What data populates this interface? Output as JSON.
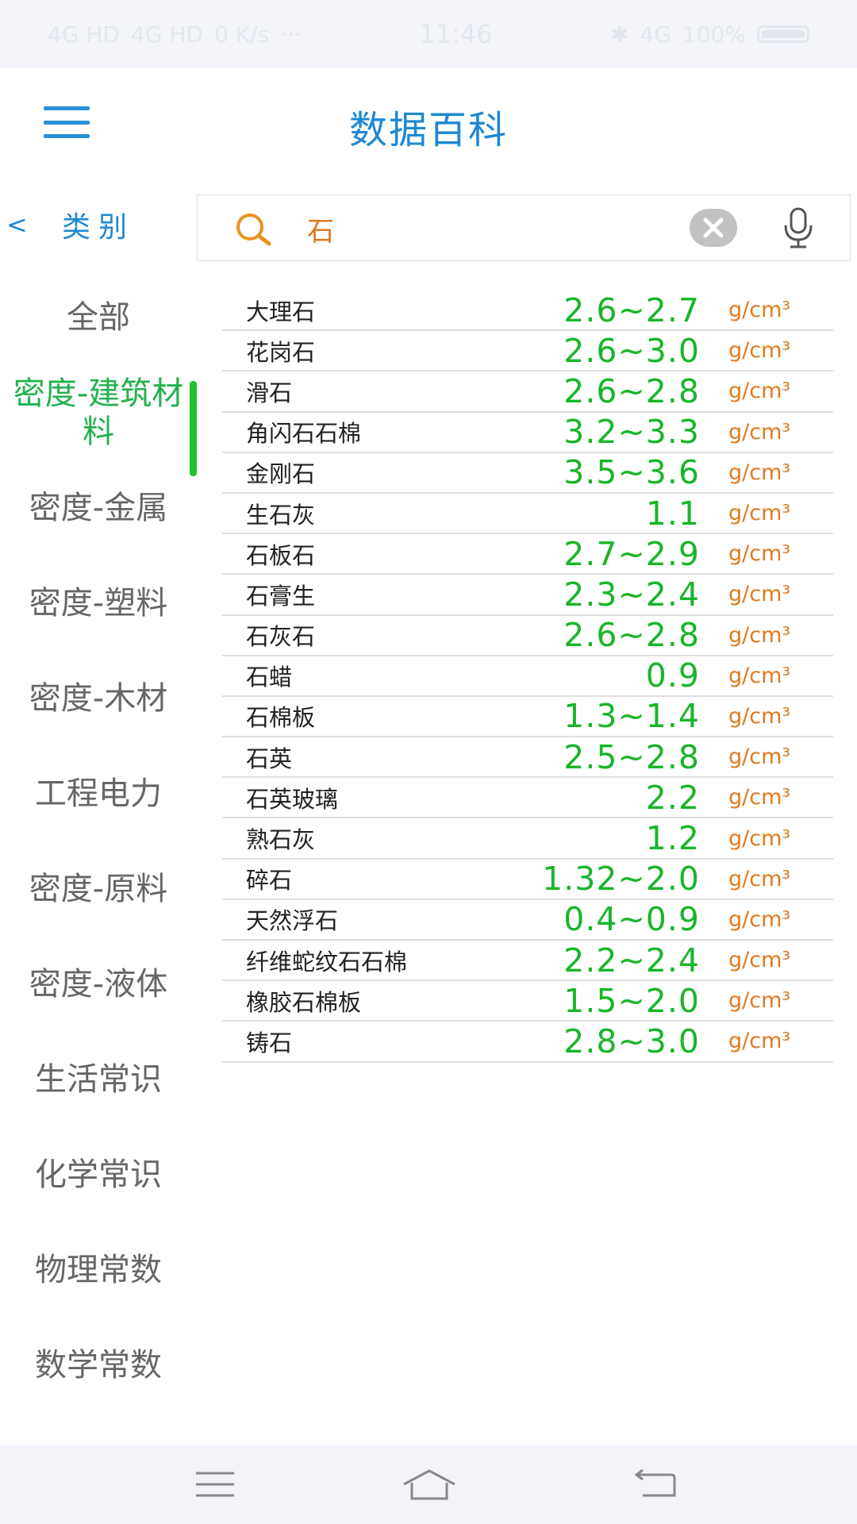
{
  "status_bar": {
    "signal1": "4G HD",
    "signal2": "4G HD",
    "speed": "0 K/s",
    "dots": "···",
    "time": "11:46",
    "network": "4G",
    "battery": "100%"
  },
  "header": {
    "title": "数据百科"
  },
  "category_header": {
    "back": "<",
    "label": "类别"
  },
  "search": {
    "value": "石",
    "placeholder": ""
  },
  "sidebar": {
    "active_index": 1,
    "items": [
      {
        "label": "全部"
      },
      {
        "label": "密度-建筑材料"
      },
      {
        "label": "密度-金属"
      },
      {
        "label": "密度-塑料"
      },
      {
        "label": "密度-木材"
      },
      {
        "label": "工程电力"
      },
      {
        "label": "密度-原料"
      },
      {
        "label": "密度-液体"
      },
      {
        "label": "生活常识"
      },
      {
        "label": "化学常识"
      },
      {
        "label": "物理常数"
      },
      {
        "label": "数学常数"
      }
    ]
  },
  "results": [
    {
      "name": "大理石",
      "value": "2.6~2.7",
      "unit": "g/cm³"
    },
    {
      "name": "花岗石",
      "value": "2.6~3.0",
      "unit": "g/cm³"
    },
    {
      "name": "滑石",
      "value": "2.6~2.8",
      "unit": "g/cm³"
    },
    {
      "name": "角闪石石棉",
      "value": "3.2~3.3",
      "unit": "g/cm³"
    },
    {
      "name": "金刚石",
      "value": "3.5~3.6",
      "unit": "g/cm³"
    },
    {
      "name": "生石灰",
      "value": "1.1",
      "unit": "g/cm³"
    },
    {
      "name": "石板石",
      "value": "2.7~2.9",
      "unit": "g/cm³"
    },
    {
      "name": "石膏生",
      "value": "2.3~2.4",
      "unit": "g/cm³"
    },
    {
      "name": "石灰石",
      "value": "2.6~2.8",
      "unit": "g/cm³"
    },
    {
      "name": "石蜡",
      "value": "0.9",
      "unit": "g/cm³"
    },
    {
      "name": "石棉板",
      "value": "1.3~1.4",
      "unit": "g/cm³"
    },
    {
      "name": "石英",
      "value": "2.5~2.8",
      "unit": "g/cm³"
    },
    {
      "name": "石英玻璃",
      "value": "2.2",
      "unit": "g/cm³"
    },
    {
      "name": "熟石灰",
      "value": "1.2",
      "unit": "g/cm³"
    },
    {
      "name": "碎石",
      "value": "1.32~2.0",
      "unit": "g/cm³"
    },
    {
      "name": "天然浮石",
      "value": "0.4~0.9",
      "unit": "g/cm³"
    },
    {
      "name": "纤维蛇纹石石棉",
      "value": "2.2~2.4",
      "unit": "g/cm³"
    },
    {
      "name": "橡胶石棉板",
      "value": "1.5~2.0",
      "unit": "g/cm³"
    },
    {
      "name": "铸石",
      "value": "2.8~3.0",
      "unit": "g/cm³"
    }
  ],
  "colors": {
    "accent_blue": "#1e88d2",
    "active_green": "#22b24c",
    "value_green": "#19b52a",
    "unit_orange": "#e07a1e"
  },
  "icons": {
    "menu": "hamburger-icon",
    "search": "search-icon",
    "clear": "clear-icon",
    "mic": "microphone-icon",
    "nav_menu": "nav-menu-icon",
    "nav_home": "nav-home-icon",
    "nav_back": "nav-back-icon"
  }
}
